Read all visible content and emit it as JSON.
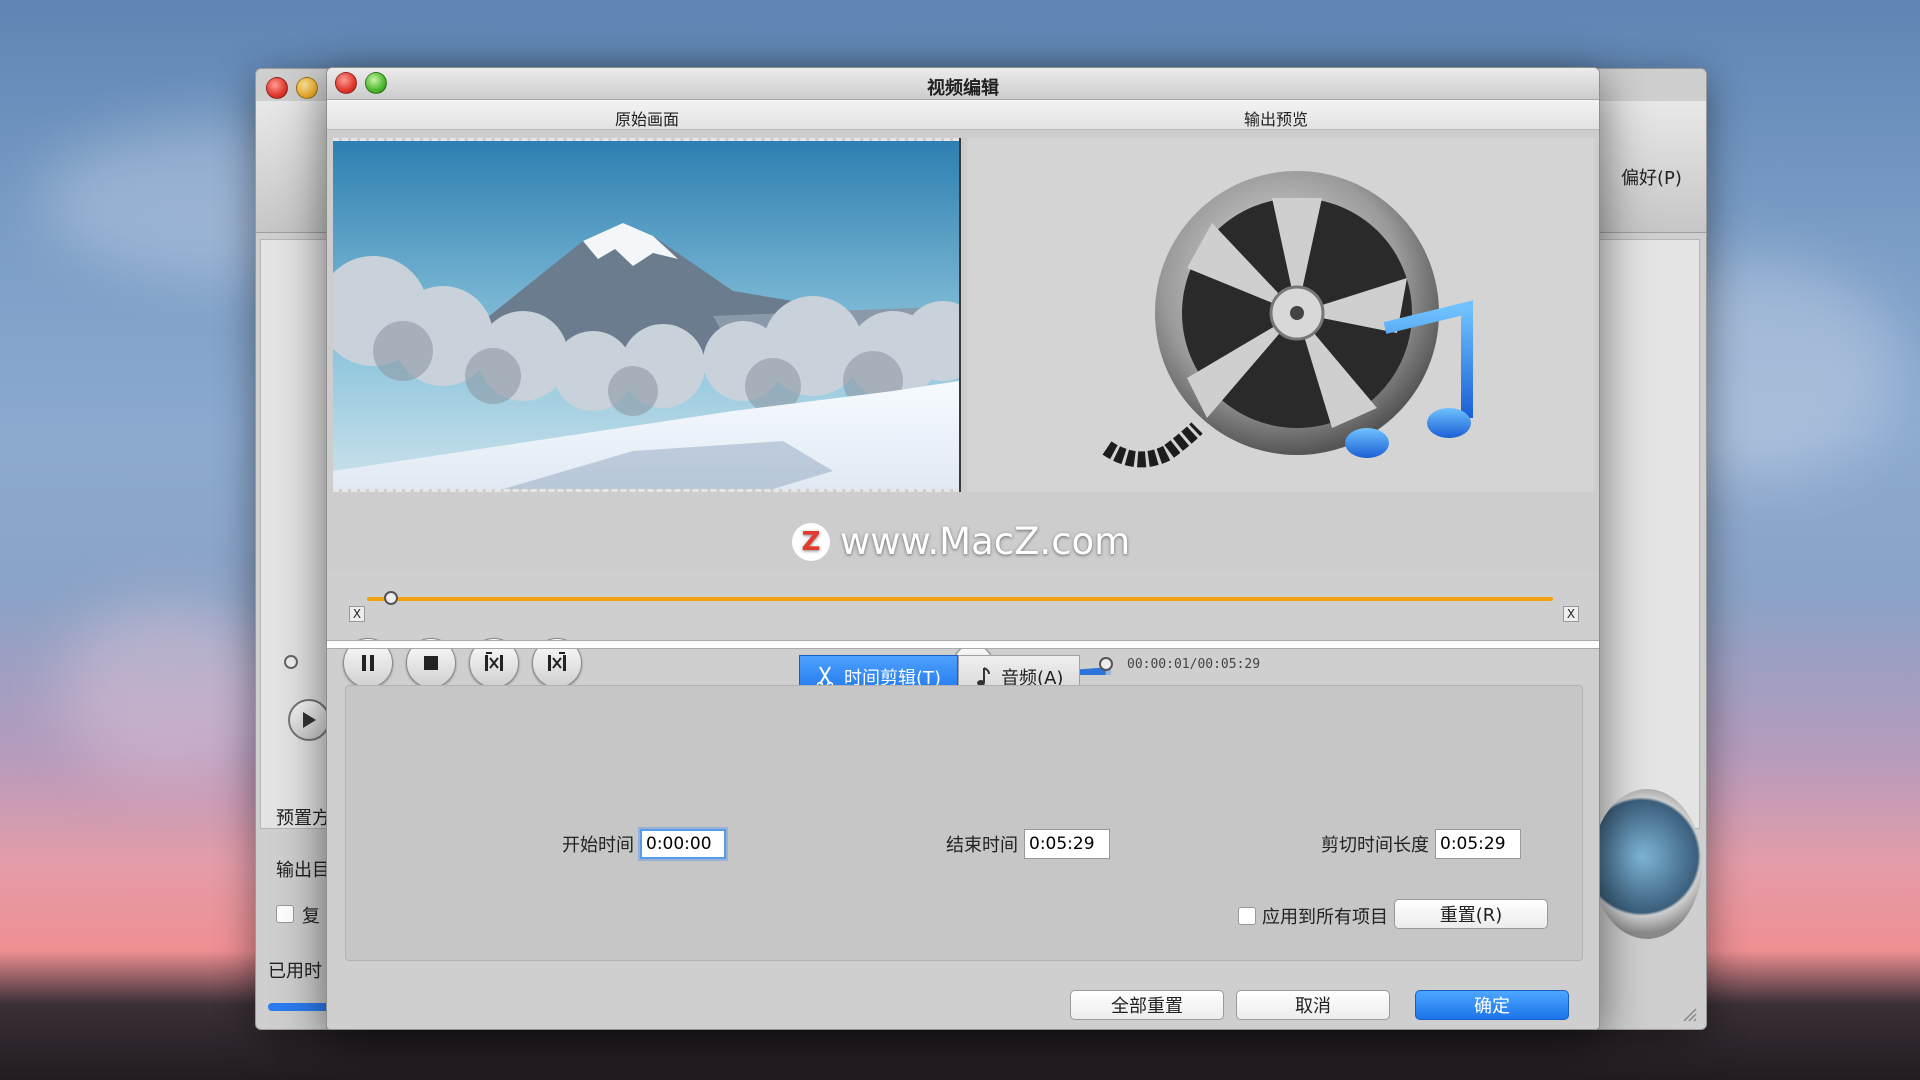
{
  "background_window": {
    "toolbar_preferences": "偏好(P)",
    "labels": {
      "preset": "预置方",
      "output": "输出目",
      "copy": "复",
      "elapsed": "已用时"
    }
  },
  "dialog": {
    "title": "视频编辑",
    "original_label": "原始画面",
    "output_label": "输出预览",
    "time_display": "00:00:01/00:05:29",
    "trim_start_marker": "X",
    "trim_end_marker": "X",
    "progress": 0.02,
    "volume": 0.95,
    "icons": {
      "pause": "pause-icon",
      "stop": "stop-icon",
      "mark_start": "mark-start-icon",
      "mark_end": "mark-end-icon",
      "volume": "speaker-icon",
      "scissors": "scissors-icon",
      "note": "music-note-icon"
    },
    "tabs": [
      {
        "label": "时间剪辑(T)",
        "active": true
      },
      {
        "label": "音频(A)",
        "active": false
      }
    ],
    "trim": {
      "start_label": "开始时间",
      "start_value": "0:00:00",
      "end_label": "结束时间",
      "end_value": "0:05:29",
      "duration_label": "剪切时间长度",
      "duration_value": "0:05:29",
      "apply_all_label": "应用到所有项目",
      "apply_all_checked": false,
      "reset_label": "重置(R)"
    },
    "buttons": {
      "reset_all": "全部重置",
      "cancel": "取消",
      "ok": "确定"
    }
  },
  "watermark": {
    "logo": "Z",
    "text": "www.MacZ.com"
  },
  "colors": {
    "accent_blue": "#1c74ea",
    "progress_orange": "#f2a20f"
  }
}
